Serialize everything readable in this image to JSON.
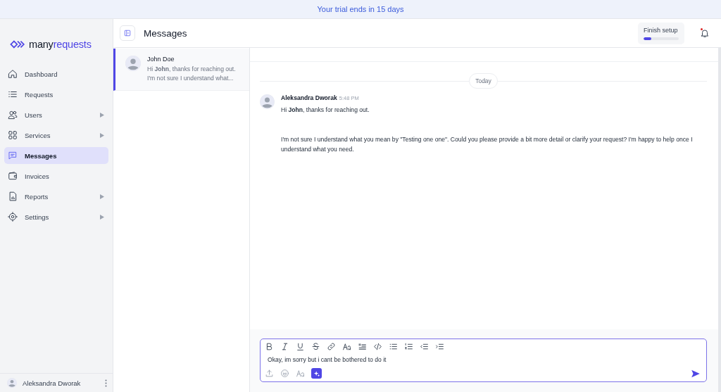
{
  "banner": {
    "text": "Your trial ends in 15 days"
  },
  "logo": {
    "prefix": "many",
    "suffix": "requests"
  },
  "sidebar": {
    "items": [
      {
        "label": "Dashboard",
        "has_submenu": false,
        "selected": false
      },
      {
        "label": "Requests",
        "has_submenu": false,
        "selected": false
      },
      {
        "label": "Users",
        "has_submenu": true,
        "selected": false
      },
      {
        "label": "Services",
        "has_submenu": true,
        "selected": false
      },
      {
        "label": "Messages",
        "has_submenu": false,
        "selected": true
      },
      {
        "label": "Invoices",
        "has_submenu": false,
        "selected": false
      },
      {
        "label": "Reports",
        "has_submenu": true,
        "selected": false
      },
      {
        "label": "Settings",
        "has_submenu": true,
        "selected": false
      }
    ],
    "user": {
      "name": "Aleksandra Dworak"
    }
  },
  "header": {
    "title": "Messages",
    "setup": {
      "label": "Finish setup",
      "level": 0.22
    },
    "notifications": {
      "unread": true
    }
  },
  "conversations": [
    {
      "name": "John Doe",
      "preview": [
        "Hi **John**, thanks for reaching out.",
        "I'm not sure I understand what..."
      ],
      "selected": true
    }
  ],
  "chat": {
    "date_divider": "Today",
    "messages": [
      {
        "author": "Aleksandra Dworak",
        "time": "5:48 PM",
        "paragraphs": [
          "Hi **John**, thanks for reaching out.",
          "I'm not sure I understand what you mean by \"Testing one one\". Could you please provide a bit more detail or clarify your request? I'm happy to help once I understand what you need."
        ]
      }
    ],
    "composer": {
      "value": "Okay, im sorry but i cant be bothered to do it"
    }
  }
}
